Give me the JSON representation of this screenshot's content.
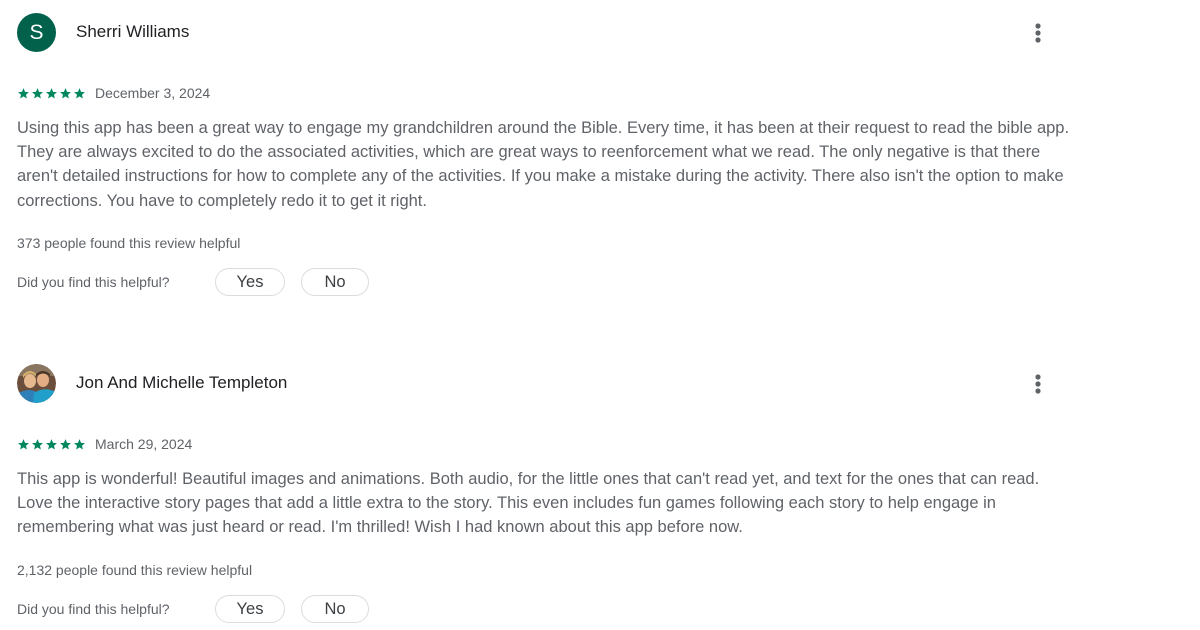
{
  "colors": {
    "star": "#01875f",
    "avatar_bg": "#01614a",
    "text_primary": "#202124",
    "text_secondary": "#5f6368",
    "pill_border": "#dadce0"
  },
  "icons": {
    "star": "star-icon",
    "more": "more-vert-icon"
  },
  "reviews": [
    {
      "author": "Sherri Williams",
      "avatar_letter": "S",
      "avatar_type": "letter",
      "rating": 5,
      "date": "December 3, 2024",
      "text": "Using this app has been a great way to engage my grandchildren around the Bible. Every time, it has been at their request to read the bible app. They are always excited to do the associated activities, which are great ways to reenforcement what we read. The only negative is that there aren't detailed instructions for how to complete any of the activities. If you make a mistake during the activity. There also isn't the option to make corrections. You have to completely redo it to get it right.",
      "helpful_count": "373 people found this review helpful",
      "helpful_question": "Did you find this helpful?",
      "yes_label": "Yes",
      "no_label": "No"
    },
    {
      "author": "Jon And Michelle Templeton",
      "avatar_letter": "",
      "avatar_type": "photo",
      "rating": 5,
      "date": "March 29, 2024",
      "text": "This app is wonderful! Beautiful images and animations. Both audio, for the little ones that can't read yet, and text for the ones that can read. Love the interactive story pages that add a little extra to the story. This even includes fun games following each story to help engage in remembering what was just heard or read. I'm thrilled! Wish I had known about this app before now.",
      "helpful_count": "2,132 people found this review helpful",
      "helpful_question": "Did you find this helpful?",
      "yes_label": "Yes",
      "no_label": "No"
    }
  ]
}
